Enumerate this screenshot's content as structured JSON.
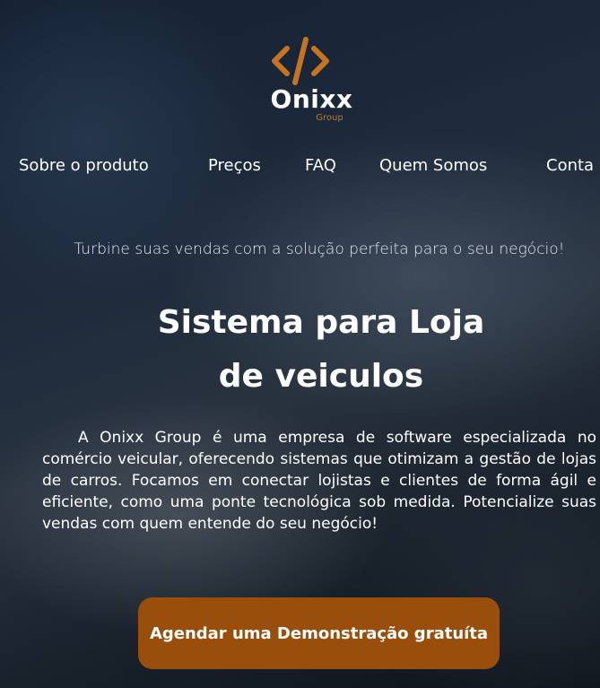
{
  "brand": {
    "name": "Onixx",
    "sub": "Group",
    "icon": "code-brackets-icon",
    "accent": "#c8741e"
  },
  "nav": {
    "items": [
      {
        "label": "Sobre o produto"
      },
      {
        "label": "Preços"
      },
      {
        "label": "FAQ"
      },
      {
        "label": "Quem Somos"
      },
      {
        "label": "Conta"
      }
    ]
  },
  "hero": {
    "tagline": "Turbine suas vendas com a solução perfeita para o seu negócio!",
    "title_line1": "Sistema para Loja",
    "title_line2": "de veiculos",
    "description": "A Onixx Group é uma empresa de software especializada no comércio veicular, oferecendo sistemas que otimizam a gestão de lojas de carros. Focamos em conectar lojistas e clientes de forma ágil e eficiente, como uma ponte tecnológica sob medida. Potencialize suas vendas com quem entende do seu negócio!",
    "cta_label": "Agendar uma Demonstração gratuíta",
    "cta_color": "#9a4e0c"
  }
}
